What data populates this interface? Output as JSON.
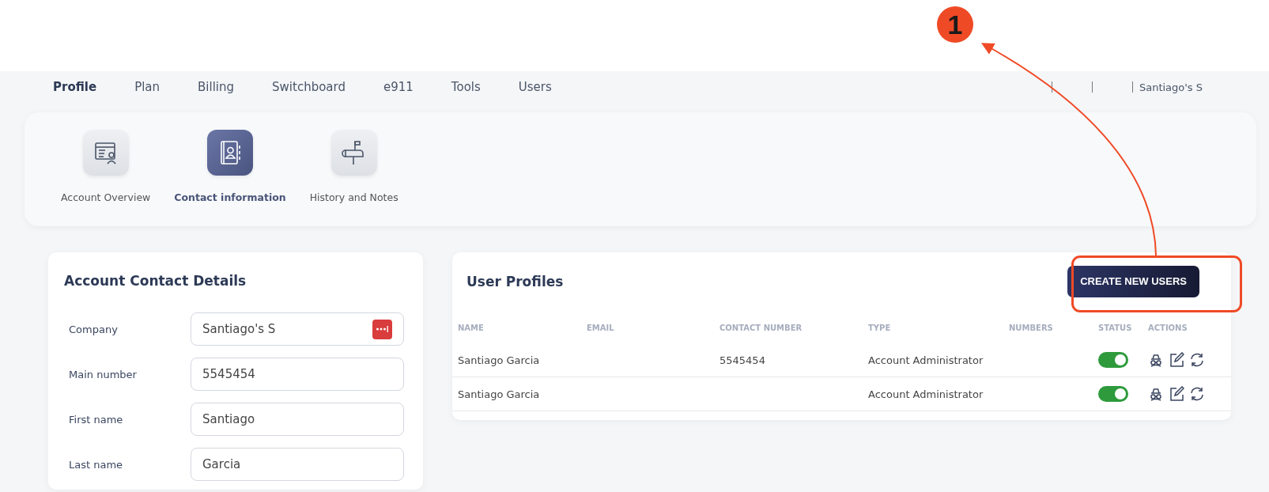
{
  "annotation": {
    "number": "1"
  },
  "nav": {
    "tabs": [
      {
        "label": "Profile",
        "selected": true
      },
      {
        "label": "Plan",
        "selected": false
      },
      {
        "label": "Billing",
        "selected": false
      },
      {
        "label": "Switchboard",
        "selected": false
      },
      {
        "label": "e911",
        "selected": false
      },
      {
        "label": "Tools",
        "selected": false
      },
      {
        "label": "Users",
        "selected": false
      }
    ],
    "account_name": "Santiago's S"
  },
  "subnav": [
    {
      "label": "Account Overview",
      "kind": "overview",
      "selected": false
    },
    {
      "label": "Contact information",
      "kind": "contacts",
      "selected": true
    },
    {
      "label": "History and Notes",
      "kind": "mailbox",
      "selected": false
    }
  ],
  "contact_details": {
    "title": "Account Contact Details",
    "fields": [
      {
        "label": "Company",
        "value": "Santiago's S",
        "password_badge": true
      },
      {
        "label": "Main number",
        "value": "5545454",
        "password_badge": false
      },
      {
        "label": "First name",
        "value": "Santiago",
        "password_badge": false
      },
      {
        "label": "Last name",
        "value": "Garcia",
        "password_badge": false
      }
    ]
  },
  "user_profiles": {
    "title": "User Profiles",
    "create_button": "CREATE NEW USERS",
    "columns": [
      "NAME",
      "EMAIL",
      "CONTACT NUMBER",
      "TYPE",
      "NUMBERS",
      "STATUS",
      "ACTIONS"
    ],
    "rows": [
      {
        "name": "Santiago Garcia",
        "contact_number": "5545454",
        "type": "Account Administrator",
        "active": true
      },
      {
        "name": "Santiago Garcia",
        "contact_number": "",
        "type": "Account Administrator",
        "active": true
      }
    ]
  }
}
